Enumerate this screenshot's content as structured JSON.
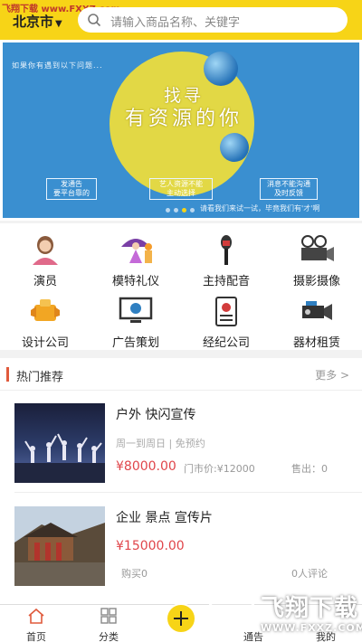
{
  "header": {
    "watermark": "飞翔下载 www.FXXZ.com",
    "city": "北京市",
    "search_placeholder": "请输入商品名称、关键字"
  },
  "banner": {
    "top_text": "如果你有遇到以下问题...",
    "title1": "找寻",
    "title2": "有资源的你",
    "tags": [
      "发通告\n要平台靠的",
      "艺人资源不能\n主动选择",
      "消息不能沟通\n及时反馈"
    ],
    "bottom_text": "请看我们来试一试，毕竟我们有'才'啊",
    "dot_count": 4,
    "active_dot": 2
  },
  "categories": [
    {
      "label": "演员",
      "icon": "actor-icon"
    },
    {
      "label": "模特礼仪",
      "icon": "model-icon"
    },
    {
      "label": "主持配音",
      "icon": "microphone-icon"
    },
    {
      "label": "摄影摄像",
      "icon": "camera-icon"
    },
    {
      "label": "设计公司",
      "icon": "design-icon"
    },
    {
      "label": "广告策划",
      "icon": "monitor-icon"
    },
    {
      "label": "经纪公司",
      "icon": "badge-icon"
    },
    {
      "label": "器材租赁",
      "icon": "video-camera-icon"
    }
  ],
  "section": {
    "title": "热门推荐",
    "more": "更多 >"
  },
  "items": [
    {
      "title": "户外 快闪宣传",
      "subtitle": "周一到周日 | 免预约",
      "price": "¥8000.00",
      "original_price": "门市价:¥12000",
      "sold": "售出：0"
    },
    {
      "title": "企业 景点 宣传片",
      "subtitle": "",
      "price": "¥15000.00",
      "bought": "购买0",
      "comments": "0人评论"
    }
  ],
  "nav": {
    "items": [
      {
        "label": "首页",
        "icon": "home-icon"
      },
      {
        "label": "分类",
        "icon": "grid-icon"
      },
      {
        "label": "",
        "icon": "plus-icon"
      },
      {
        "label": "通告",
        "icon": "notice-icon"
      },
      {
        "label": "我的",
        "icon": "user-icon"
      }
    ]
  },
  "watermark": {
    "text": "飞翔下载",
    "url": "WWW.FXXZ.COM"
  }
}
